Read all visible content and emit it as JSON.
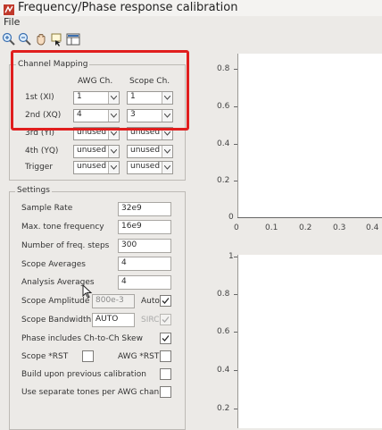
{
  "window": {
    "title": "Frequency/Phase response calibration"
  },
  "menu": {
    "file": "File"
  },
  "toolbar": {
    "icons": [
      "zoom-in-icon",
      "zoom-out-icon",
      "pan-icon",
      "data-cursor-icon",
      "plot-browser-icon"
    ]
  },
  "channel_mapping": {
    "title": "Channel Mapping",
    "col_awg": "AWG Ch.",
    "col_scope": "Scope Ch.",
    "rows": [
      {
        "label": "1st (XI)",
        "awg": "1",
        "scope": "1"
      },
      {
        "label": "2nd (XQ)",
        "awg": "4",
        "scope": "3"
      },
      {
        "label": "3rd (YI)",
        "awg": "unused",
        "scope": "unused"
      },
      {
        "label": "4th (YQ)",
        "awg": "unused",
        "scope": "unused"
      },
      {
        "label": "Trigger",
        "awg": "unused",
        "scope": "unused"
      }
    ]
  },
  "settings": {
    "title": "Settings",
    "sample_rate": {
      "label": "Sample Rate",
      "value": "32e9"
    },
    "max_tone": {
      "label": "Max. tone frequency",
      "value": "16e9"
    },
    "freq_steps": {
      "label": "Number of freq. steps",
      "value": "300"
    },
    "scope_avg": {
      "label": "Scope Averages",
      "value": "4"
    },
    "analysis_avg": {
      "label": "Analysis Averages",
      "value": "4"
    },
    "scope_amp": {
      "label": "Scope Amplitude",
      "value": "800e-3",
      "auto_label": "Auto",
      "auto_checked": true
    },
    "scope_bw": {
      "label": "Scope Bandwidth",
      "value": "AUTO",
      "sirc_label": "SIRC",
      "sirc_checked": true
    },
    "phase_skew": {
      "label": "Phase includes Ch-to-Ch Skew",
      "checked": true
    },
    "scope_rst": {
      "label": "Scope *RST",
      "checked": false
    },
    "awg_rst": {
      "label": "AWG *RST",
      "checked": false
    },
    "build_upon": {
      "label": "Build upon previous calibration",
      "checked": false
    },
    "separate_tones": {
      "label": "Use separate tones per AWG channel",
      "checked": false
    }
  },
  "plot_top": {
    "y_ticks": [
      "0.8",
      "0.6",
      "0.4",
      "0.2",
      "0"
    ],
    "x_ticks": [
      "0",
      "0.1",
      "0.2",
      "0.3",
      "0.4"
    ]
  },
  "plot_bottom": {
    "y_ticks": [
      "1",
      "0.8",
      "0.6",
      "0.4",
      "0.2"
    ]
  },
  "colors": {
    "highlight": "#e01e1e",
    "accent_check": "#2a5aa8"
  }
}
